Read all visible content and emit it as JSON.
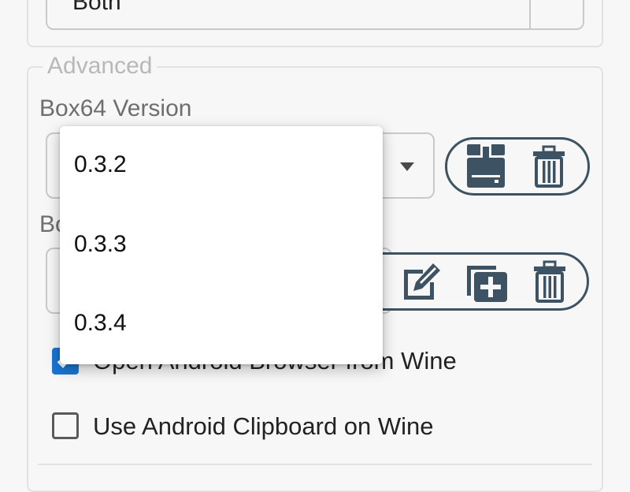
{
  "top_section": {
    "selected_value": "Both"
  },
  "advanced": {
    "legend": "Advanced",
    "box64_version_label": "Box64 Version",
    "box64_preset_label_visible": "Bo",
    "box64_version_options": [
      "0.3.2",
      "0.3.3",
      "0.3.4"
    ]
  },
  "checkboxes": {
    "open_android_browser": {
      "label": "Open Android Browser from Wine",
      "checked": true
    },
    "use_android_clipboard": {
      "label": "Use Android Clipboard on Wine",
      "checked": false
    }
  },
  "icons": {
    "install": "download-icon",
    "remove": "trash-icon",
    "edit": "edit-icon",
    "duplicate": "add-copy-icon",
    "remove_preset": "trash-icon"
  },
  "colors": {
    "accent": "#1976d2",
    "icon": "#3d5363",
    "legend": "#b8b8b8"
  }
}
